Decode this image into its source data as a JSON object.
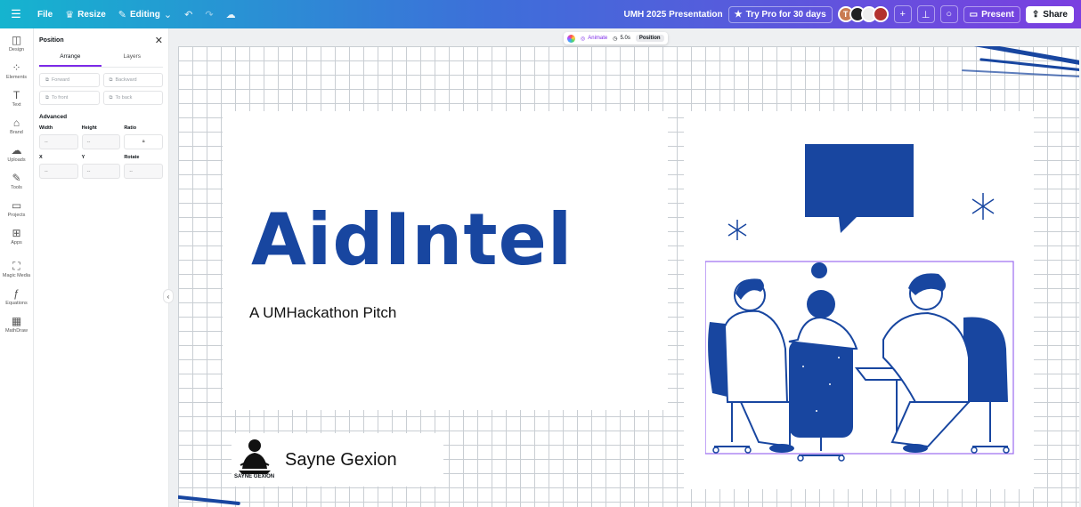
{
  "topbar": {
    "file_label": "File",
    "resize_label": "Resize",
    "editing_label": "Editing",
    "presentation_title": "UMH 2025 Presentation",
    "try_pro_label": "Try Pro for 30 days",
    "avatar_initial": "T",
    "present_label": "Present",
    "share_label": "Share"
  },
  "rail": {
    "items": [
      {
        "label": "Design",
        "icon": "design-icon"
      },
      {
        "label": "Elements",
        "icon": "elements-icon"
      },
      {
        "label": "Text",
        "icon": "text-icon"
      },
      {
        "label": "Brand",
        "icon": "brand-icon"
      },
      {
        "label": "Uploads",
        "icon": "uploads-icon"
      },
      {
        "label": "Tools",
        "icon": "tools-icon"
      },
      {
        "label": "Projects",
        "icon": "projects-icon"
      },
      {
        "label": "Apps",
        "icon": "apps-icon"
      },
      {
        "label": "Magic Media",
        "icon": "magic-media-icon"
      },
      {
        "label": "Equations",
        "icon": "equations-icon"
      },
      {
        "label": "MathDraw",
        "icon": "mathdraw-icon"
      }
    ]
  },
  "panel": {
    "title": "Position",
    "tabs": [
      "Arrange",
      "Layers"
    ],
    "arrange_buttons": [
      "Forward",
      "Backward",
      "To front",
      "To back"
    ],
    "advanced_label": "Advanced",
    "field_labels_1": [
      "Width",
      "Height",
      "Ratio"
    ],
    "field_labels_2": [
      "X",
      "Y",
      "Rotate"
    ],
    "empty_value": "--"
  },
  "floatbar": {
    "animate_label": "Animate",
    "duration_label": "5.0s",
    "position_label": "Position"
  },
  "slide": {
    "title": "AidIntel",
    "subtitle": "A UMHackathon Pitch",
    "logo_name": "Sayne Gexion",
    "logo_caption": "SAYNE GEXION"
  },
  "colors": {
    "brand_blue": "#1846a0",
    "accent_purple": "#7d2ae8",
    "grid_line": "#c9ced3"
  }
}
